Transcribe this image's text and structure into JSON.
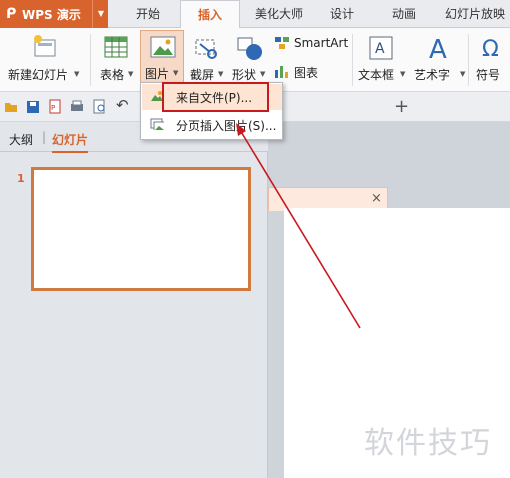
{
  "app": {
    "title": "WPS 演示"
  },
  "tabs": [
    "开始",
    "插入",
    "美化大师",
    "设计",
    "动画",
    "幻灯片放映"
  ],
  "ribbon": {
    "new_slide": "新建幻灯片",
    "table": "表格",
    "picture": "图片",
    "screenshot": "截屏",
    "shape": "形状",
    "smartart": "SmartArt",
    "chart": "图表",
    "textbox": "文本框",
    "wordart": "艺术字",
    "symbol": "符号"
  },
  "picture_menu": {
    "from_file": "来自文件(P)...",
    "paged_insert": "分页插入图片(S)..."
  },
  "qat": {
    "add_tab": "+",
    "close": "×"
  },
  "panel": {
    "tab_outline": "大纲",
    "tab_slides": "幻灯片",
    "slide_number": "1"
  },
  "watermark": "软件技巧",
  "colors": {
    "accent": "#d9632c",
    "annotation": "#c8191f"
  }
}
